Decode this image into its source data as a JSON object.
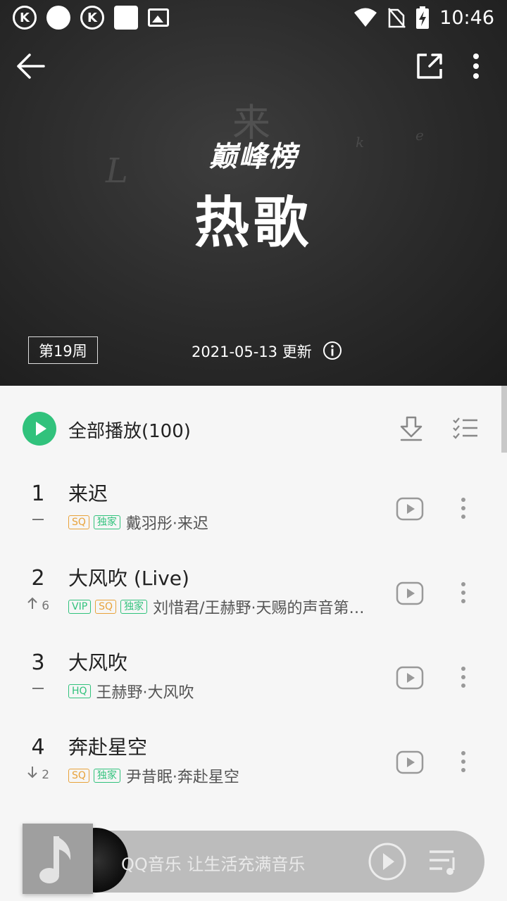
{
  "status_bar": {
    "time": "10:46",
    "left_icons": [
      "k-music-icon",
      "netease-icon",
      "k-music-icon",
      "white-square-icon",
      "image-icon"
    ],
    "right_icons": [
      "wifi-icon",
      "no-sim-icon",
      "battery-charging-icon"
    ]
  },
  "header": {
    "brand": "巅峰榜",
    "chart_title": "热歌",
    "week_label": "第19周",
    "update_text": "2021-05-13 更新"
  },
  "list": {
    "play_all_label": "全部播放(100)",
    "songs": [
      {
        "rank": "1",
        "trend": "",
        "trend_dir": "flat",
        "title": "来迟",
        "tags": [
          "SQ",
          "独家"
        ],
        "artist": "戴羽彤·来迟"
      },
      {
        "rank": "2",
        "trend": "6",
        "trend_dir": "up",
        "title": "大风吹 (Live)",
        "tags": [
          "VIP",
          "SQ",
          "独家"
        ],
        "artist": "刘惜君/王赫野·天赐的声音第…"
      },
      {
        "rank": "3",
        "trend": "",
        "trend_dir": "flat",
        "title": "大风吹",
        "tags": [
          "HQ"
        ],
        "artist": "王赫野·大风吹"
      },
      {
        "rank": "4",
        "trend": "2",
        "trend_dir": "down",
        "title": "奔赴星空",
        "tags": [
          "SQ",
          "独家"
        ],
        "artist": "尹昔眠·奔赴星空"
      }
    ]
  },
  "mini_player": {
    "text": "QQ音乐 让生活充满音乐"
  },
  "colors": {
    "accent_green": "#31c27c",
    "sq_orange": "#e8a23a"
  }
}
